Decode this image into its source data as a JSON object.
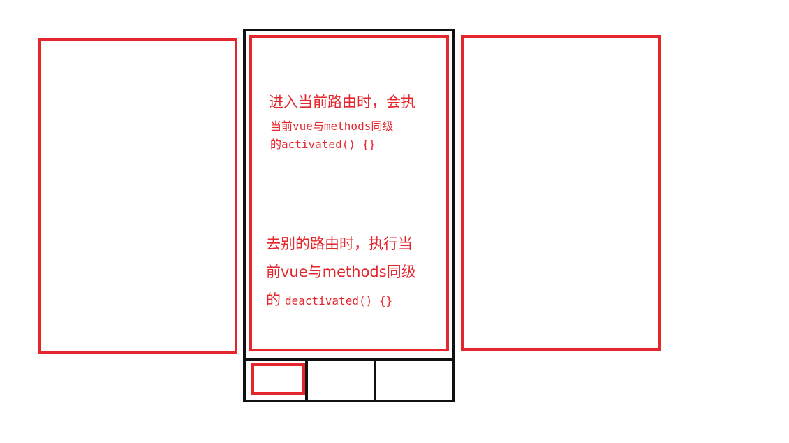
{
  "colors": {
    "route_page": "#e5262d",
    "phone_frame": "#111111",
    "annotation_text": "#e5262d"
  },
  "enter_note": {
    "line1": "进入当前路由时，会执",
    "line2": "当前vue与methods同级",
    "line3": "的activated() {}"
  },
  "leave_note": {
    "line1": "去别的路由时，执行当",
    "line2": "前vue与methods同级",
    "line3_prefix": "的",
    "line3_code": "deactivated() {}"
  }
}
